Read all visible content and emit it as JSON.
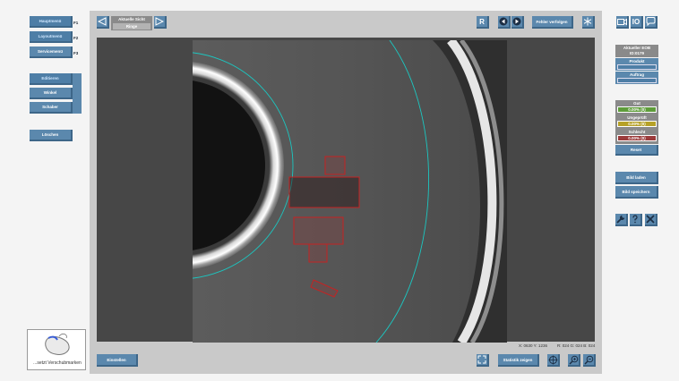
{
  "nav": {
    "hauptmenu": {
      "label": "Hauptmenü",
      "key": "F1"
    },
    "layoutmenu": {
      "label": "Layoutmenü",
      "key": "F2"
    },
    "servicemenu": {
      "label": "Servicemenü",
      "key": "F3"
    }
  },
  "tools": {
    "editieren": "Editieren",
    "winkel": "Winkel",
    "schaber": "Schaber",
    "loeschen": "Löschen"
  },
  "mouse_hint": "...setzt Verschubmarken",
  "top": {
    "current_view_label": "Aktuelle Sicht",
    "current_view_value": "Ringe",
    "r_button": "R",
    "errors_button": "Fehler verfolgen"
  },
  "status_bar": {
    "coords": "X: 0630  Y: 1236",
    "rgb": "R: 024  G: 024  B: 024"
  },
  "bottom": {
    "einstellen": "Einstellen",
    "statistik": "Statistik zeigen"
  },
  "right": {
    "io_label": "IO",
    "current_eob_label": "Aktueller EOB",
    "current_eob_value": "ID:0179",
    "produkt_label": "Produkt",
    "produkt_value": "",
    "auftrag_label": "Auftrag",
    "auftrag_value": "",
    "gut_label": "Gut",
    "gut_value": "0.00% (0)",
    "ungepruft_label": "Ungeprüft",
    "ungepruft_value": "0.00% (0)",
    "schlecht_label": "Schlecht",
    "schlecht_value": "0.00% (0)",
    "reset": "Reset",
    "bild_laden": "Bild laden",
    "bild_speichern": "Bild speichern"
  },
  "colors": {
    "panel": "#c9c9c9",
    "button": "#5b88ad",
    "gut": "#5e9c3a",
    "ungepruft": "#b6a127",
    "schlecht": "#9b3b3b",
    "ring_cyan": "#1bc7c1",
    "defect_red": "#c42323"
  }
}
